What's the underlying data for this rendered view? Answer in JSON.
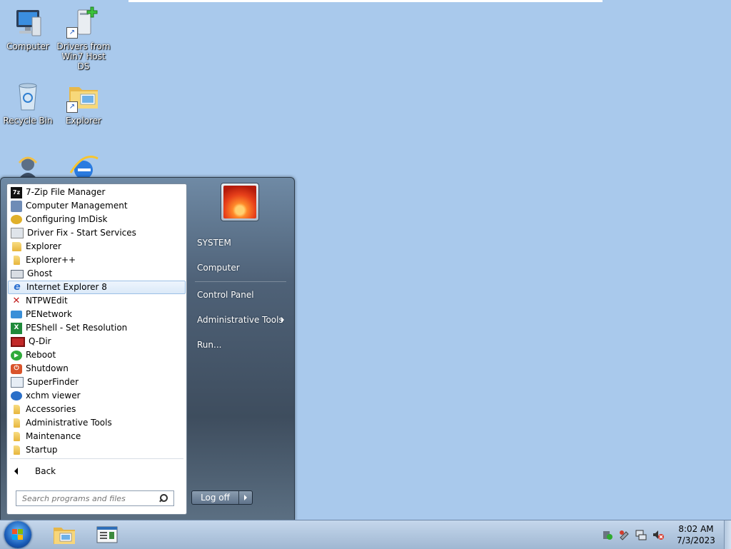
{
  "desktop": {
    "icons": [
      {
        "label": "Computer",
        "icon": "computer-icon"
      },
      {
        "label": "Drivers from Win7 Host DS",
        "label_line1": "Drivers from",
        "label_line2": "Win7 Host DS",
        "icon": "driver-install-icon"
      },
      {
        "label": "Recycle Bin",
        "icon": "recycle-bin-icon"
      },
      {
        "label": "Explorer",
        "icon": "folder-explorer-icon"
      },
      {
        "label": "",
        "icon": "user-icon"
      },
      {
        "label": "",
        "icon": "internet-explorer-icon"
      }
    ]
  },
  "start_menu": {
    "programs": [
      {
        "label": "7-Zip File Manager",
        "icon": "7zip-icon"
      },
      {
        "label": "Computer Management",
        "icon": "computer-management-icon"
      },
      {
        "label": "Configuring ImDisk",
        "icon": "imdisk-icon"
      },
      {
        "label": "Driver Fix - Start Services",
        "icon": "driver-fix-icon"
      },
      {
        "label": "Explorer",
        "icon": "explorer-icon"
      },
      {
        "label": "Explorer++",
        "icon": "explorerpp-icon"
      },
      {
        "label": "Ghost",
        "icon": "ghost-icon"
      },
      {
        "label": "Internet Explorer 8",
        "icon": "internet-explorer-icon",
        "highlighted": true
      },
      {
        "label": "NTPWEdit",
        "icon": "ntpwedit-icon"
      },
      {
        "label": "PENetwork",
        "icon": "penetwork-icon"
      },
      {
        "label": "PEShell - Set Resolution",
        "icon": "peshell-icon"
      },
      {
        "label": "Q-Dir",
        "icon": "qdir-icon"
      },
      {
        "label": "Reboot",
        "icon": "reboot-icon"
      },
      {
        "label": "Shutdown",
        "icon": "shutdown-icon"
      },
      {
        "label": "SuperFinder",
        "icon": "superfinder-icon"
      },
      {
        "label": "xchm viewer",
        "icon": "xchm-icon"
      },
      {
        "label": "Accessories",
        "icon": "folder-icon"
      },
      {
        "label": "Administrative Tools",
        "icon": "folder-icon"
      },
      {
        "label": "Maintenance",
        "icon": "folder-icon"
      },
      {
        "label": "Startup",
        "icon": "folder-icon"
      }
    ],
    "back_label": "Back",
    "search_placeholder": "Search programs and files",
    "right_items": {
      "user": "SYSTEM",
      "computer": "Computer",
      "control_panel": "Control Panel",
      "admin_tools": "Administrative Tools",
      "run": "Run..."
    },
    "logoff_label": "Log off"
  },
  "taskbar": {
    "pinned": [
      "folder-explorer-icon",
      "window-app-icon"
    ],
    "time": "8:02 AM",
    "date": "7/3/2023",
    "tray_icons": [
      "security-icon",
      "usb-icon",
      "network-icon",
      "volume-muted-icon"
    ]
  }
}
